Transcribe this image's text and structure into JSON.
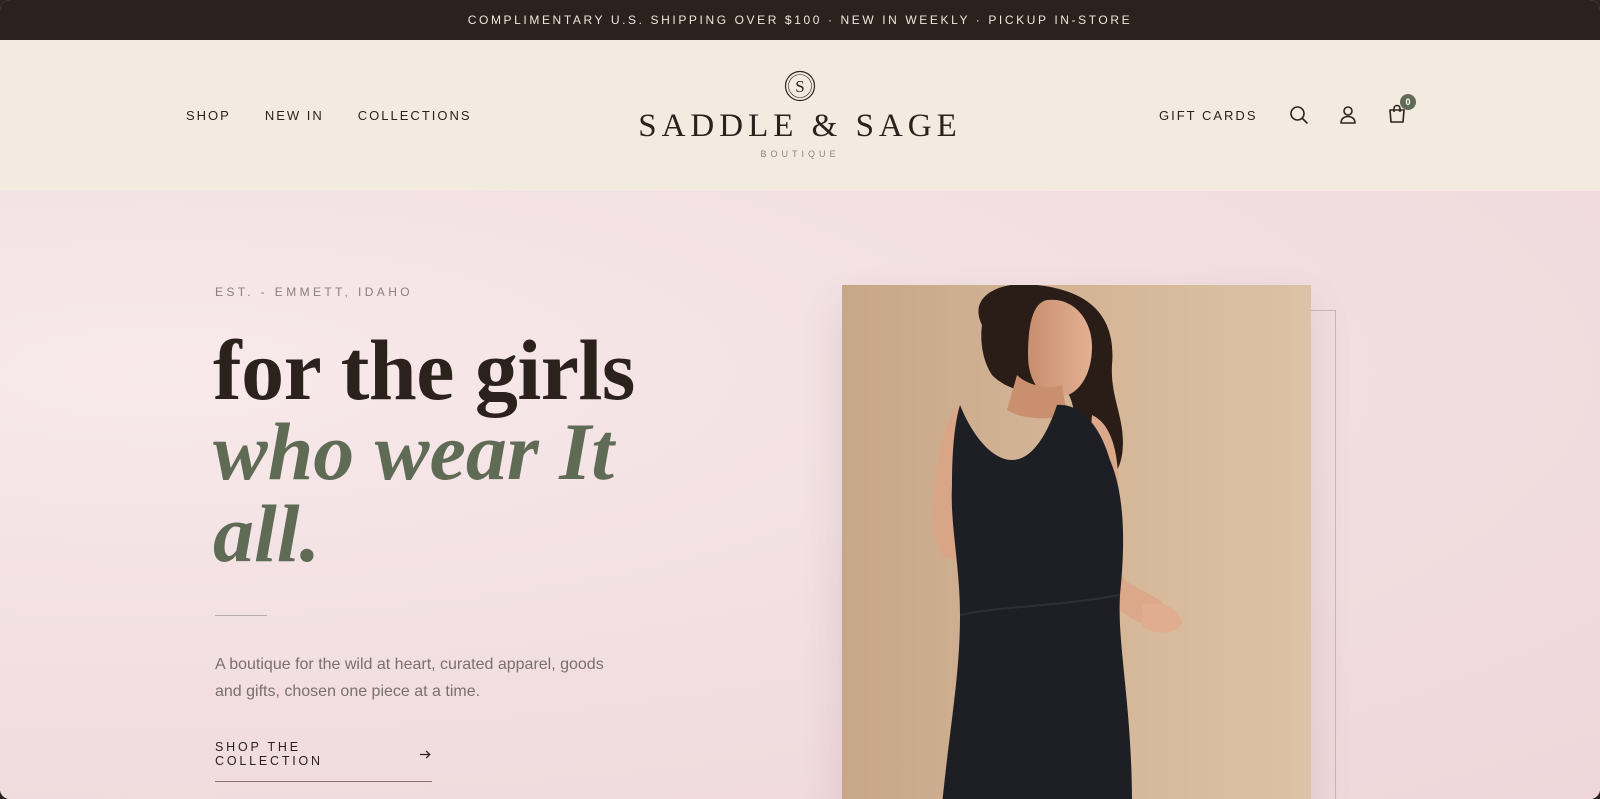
{
  "announcement": {
    "text": "COMPLIMENTARY U.S. SHIPPING OVER $100 · NEW IN WEEKLY · PICKUP IN-STORE"
  },
  "nav": {
    "left": [
      {
        "label": "SHOP"
      },
      {
        "label": "NEW IN"
      },
      {
        "label": "COLLECTIONS"
      }
    ],
    "gift_cards": "GIFT CARDS",
    "cart_count": "0",
    "icons": [
      "search-icon",
      "account-icon",
      "cart-icon"
    ]
  },
  "logo": {
    "monogram": "S",
    "name": "SADDLE & SAGE",
    "sub": "BOUTIQUE"
  },
  "hero": {
    "eyebrow": "EST. - EMMETT, IDAHO",
    "headline": "for the girls",
    "headline_accent": "who wear It all.",
    "lede": "A boutique for the wild at heart, curated apparel, goods and gifts, chosen one piece at a time.",
    "cta": "SHOP THE COLLECTION"
  },
  "colors": {
    "dark": "#2b221e",
    "cream": "#f4ebe0",
    "sage": "#5f6b55",
    "blush": "#f2e0e2"
  }
}
